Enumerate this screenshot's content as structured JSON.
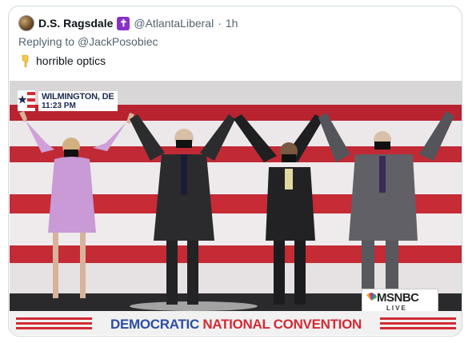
{
  "tweet": {
    "display_name": "D.S. Ragsdale",
    "badge_icon": "latin-cross-icon",
    "handle": "@AtlantaLiberal",
    "separator": "·",
    "time": "1h",
    "reply_prefix": "Replying to",
    "reply_to": "@JackPosobiec",
    "body_emoji": "backhand-index-pointing-down-emoji",
    "body_text": "horrible optics"
  },
  "media": {
    "location_city": "WILMINGTON, DE",
    "location_time": "11:23 PM",
    "network": "MSNBC",
    "network_live": "LIVE",
    "banner_part1": "DEMOCRATIC",
    "banner_part2": "NATIONAL CONVENTION"
  },
  "colors": {
    "badge": "#8b2fc9",
    "banner_blue": "#2c4fa0",
    "banner_red": "#d22b35",
    "stripe_red": "#b8232f"
  }
}
